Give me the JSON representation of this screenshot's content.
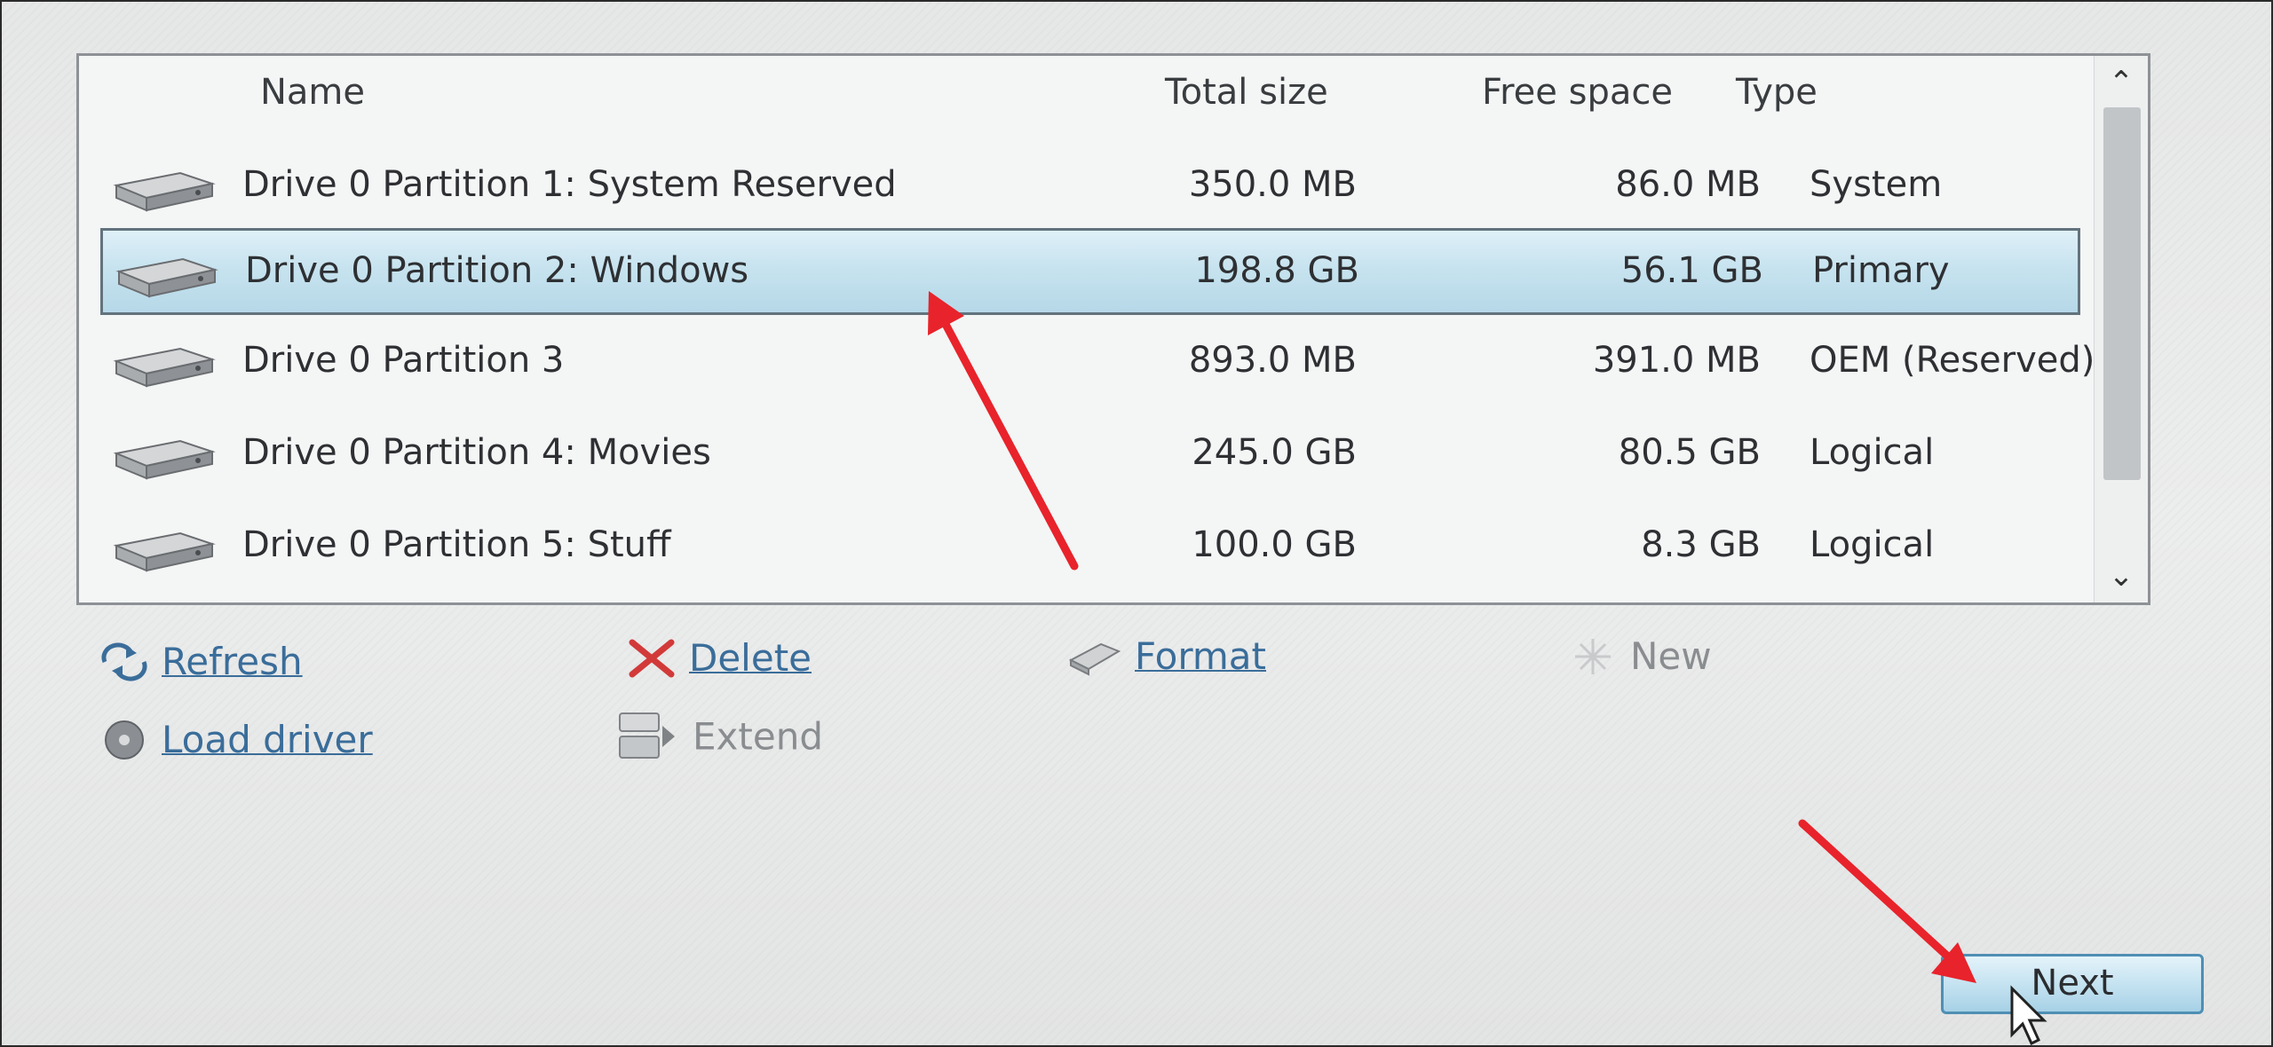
{
  "columns": {
    "name": "Name",
    "total_size": "Total size",
    "free_space": "Free space",
    "type": "Type"
  },
  "partitions": [
    {
      "name": "Drive 0 Partition 1: System Reserved",
      "total": "350.0 MB",
      "free": "86.0 MB",
      "type": "System",
      "selected": false
    },
    {
      "name": "Drive 0 Partition 2: Windows",
      "total": "198.8 GB",
      "free": "56.1 GB",
      "type": "Primary",
      "selected": true
    },
    {
      "name": "Drive 0 Partition 3",
      "total": "893.0 MB",
      "free": "391.0 MB",
      "type": "OEM (Reserved)",
      "selected": false
    },
    {
      "name": "Drive 0 Partition 4: Movies",
      "total": "245.0 GB",
      "free": "80.5 GB",
      "type": "Logical",
      "selected": false
    },
    {
      "name": "Drive 0 Partition 5: Stuff",
      "total": "100.0 GB",
      "free": "8.3 GB",
      "type": "Logical",
      "selected": false
    }
  ],
  "actions": {
    "refresh": "Refresh",
    "delete": "Delete",
    "format": "Format",
    "new": "New",
    "load_driver": "Load driver",
    "extend": "Extend"
  },
  "next_button": "Next",
  "colors": {
    "selection": "#c7e3ef",
    "link": "#3a6d9a",
    "annotation_arrow": "#e8232b"
  }
}
